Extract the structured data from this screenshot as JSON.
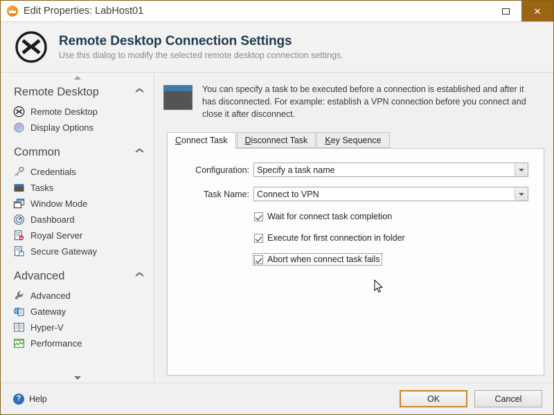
{
  "titlebar": {
    "icon": "royal-ts-logo-icon",
    "title": "Edit Properties: LabHost01",
    "maximize_label": "",
    "close_label": "✕"
  },
  "header": {
    "icon": "remote-desktop-icon",
    "title": "Remote Desktop Connection Settings",
    "subtitle": "Use this dialog to modify the selected remote desktop connection settings."
  },
  "sidebar": {
    "scroll_up": "▲",
    "scroll_down": "▼",
    "groups": [
      {
        "title": "Remote Desktop",
        "collapse_icon": "chevron-up-icon",
        "items": [
          {
            "label": "Remote Desktop",
            "icon": "remote-desktop-icon"
          },
          {
            "label": "Display Options",
            "icon": "color-wheel-icon"
          }
        ]
      },
      {
        "title": "Common",
        "collapse_icon": "chevron-up-icon",
        "items": [
          {
            "label": "Credentials",
            "icon": "key-icon"
          },
          {
            "label": "Tasks",
            "icon": "task-window-icon"
          },
          {
            "label": "Window Mode",
            "icon": "window-mode-icon"
          },
          {
            "label": "Dashboard",
            "icon": "gauge-icon"
          },
          {
            "label": "Royal Server",
            "icon": "royal-server-icon"
          },
          {
            "label": "Secure Gateway",
            "icon": "secure-gateway-icon"
          }
        ]
      },
      {
        "title": "Advanced",
        "collapse_icon": "chevron-up-icon",
        "items": [
          {
            "label": "Advanced",
            "icon": "wrench-icon"
          },
          {
            "label": "Gateway",
            "icon": "globe-document-icon"
          },
          {
            "label": "Hyper-V",
            "icon": "hyperv-icon"
          },
          {
            "label": "Performance",
            "icon": "performance-chart-icon"
          }
        ]
      }
    ]
  },
  "main": {
    "info": {
      "icon": "task-window-icon",
      "text": "You can specify a task to be executed before a connection is established and after it has disconnected. For example: establish a VPN connection before you connect and close it after disconnect."
    },
    "tabs": [
      {
        "label": "Connect Task",
        "accel": "C",
        "rest": "onnect Task",
        "active": true
      },
      {
        "label": "Disconnect Task",
        "accel": "D",
        "rest": "isconnect Task",
        "active": false
      },
      {
        "label": "Key Sequence",
        "accel": "K",
        "rest": "ey Sequence",
        "active": false
      }
    ],
    "fields": [
      {
        "label": "Configuration:",
        "value": "Specify a task name",
        "control": "combobox",
        "name": "configuration-combobox"
      },
      {
        "label": "Task Name:",
        "value": "Connect to VPN",
        "control": "combobox",
        "name": "task-name-combobox"
      }
    ],
    "checkboxes": [
      {
        "label": "Wait for connect task completion",
        "checked": true,
        "focused": false
      },
      {
        "label": "Execute for first connection in folder",
        "checked": true,
        "focused": false
      },
      {
        "label": "Abort when connect task fails",
        "checked": true,
        "focused": true
      }
    ]
  },
  "footer": {
    "help_label": "Help",
    "help_icon": "question-mark-icon",
    "ok_label": "OK",
    "cancel_label": "Cancel"
  },
  "colors": {
    "window_border": "#8a5d19",
    "close_button": "#9a6614",
    "default_button_border": "#c8841f",
    "header_title": "#1f3b4d",
    "accent_blue": "#3a7ab5"
  }
}
